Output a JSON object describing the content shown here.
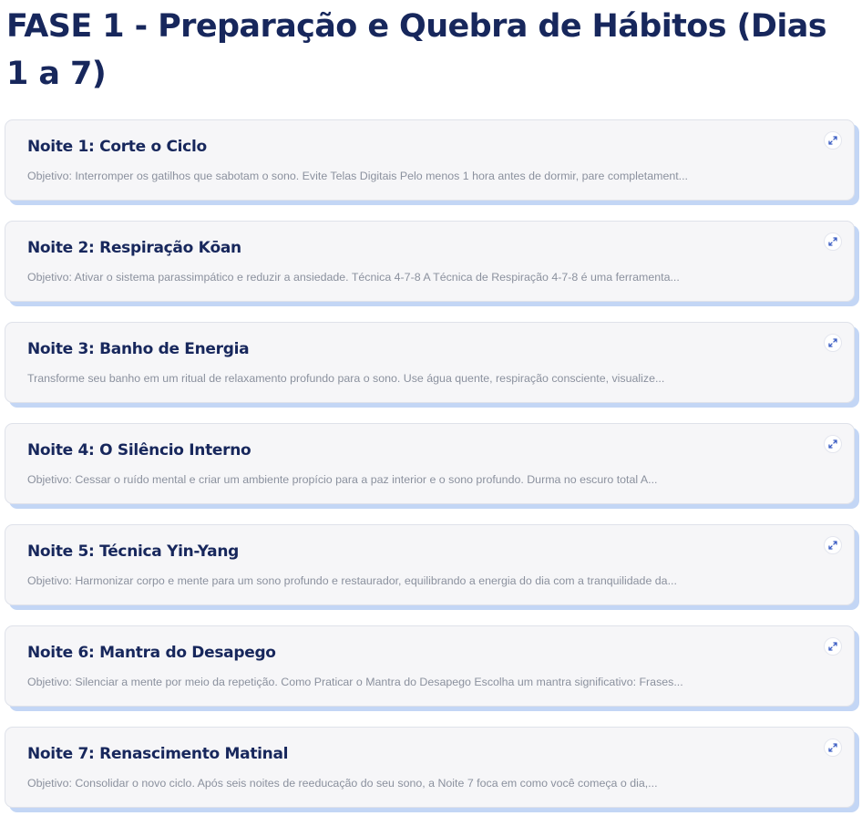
{
  "phase": {
    "title": "FASE 1 - Preparação e Quebra de Hábitos (Dias 1 a 7)"
  },
  "expand_icon": "expand-diagonal-icon",
  "colors": {
    "title": "#17275c",
    "card_bg": "#f6f6f8",
    "card_shadow": "#c3d6f5",
    "description": "#8b919e",
    "icon": "#3d5fc4"
  },
  "cards": [
    {
      "title": "Noite 1: Corte o Ciclo",
      "description": "Objetivo: Interromper os gatilhos que sabotam o sono. Evite Telas Digitais Pelo menos 1 hora antes de dormir, pare completament..."
    },
    {
      "title": "Noite 2: Respiração Kōan",
      "description": "Objetivo: Ativar o sistema parassimpático e reduzir a ansiedade. Técnica 4-7-8 A Técnica de Respiração 4-7-8 é uma ferramenta..."
    },
    {
      "title": "Noite 3: Banho de Energia",
      "description": "Transforme seu banho em um ritual de relaxamento profundo para o sono. Use água quente, respiração consciente, visualize..."
    },
    {
      "title": "Noite 4: O Silêncio Interno",
      "description": "Objetivo: Cessar o ruído mental e criar um ambiente propício para a paz interior e o sono profundo. Durma no escuro total A..."
    },
    {
      "title": "Noite 5: Técnica Yin-Yang",
      "description": "Objetivo: Harmonizar corpo e mente para um sono profundo e restaurador, equilibrando a energia do dia com a tranquilidade da..."
    },
    {
      "title": "Noite 6: Mantra do Desapego",
      "description": "Objetivo: Silenciar a mente por meio da repetição. Como Praticar o Mantra do Desapego Escolha um mantra significativo: Frases..."
    },
    {
      "title": "Noite 7: Renascimento Matinal",
      "description": "Objetivo: Consolidar o novo ciclo. Após seis noites de reeducação do seu sono, a Noite 7 foca em como você começa o dia,..."
    }
  ]
}
